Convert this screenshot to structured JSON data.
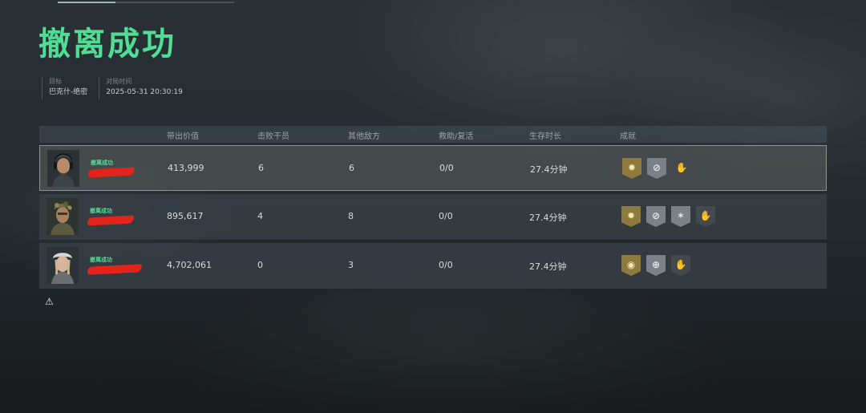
{
  "title": "撤离成功",
  "meta": {
    "target_label": "目标",
    "target_value": "巴克什-绝密",
    "time_label": "对局时间",
    "time_value": "2025-05-31 20:30:19"
  },
  "table": {
    "headers": {
      "value": "带出价值",
      "defeated": "击败干员",
      "other": "其他敌方",
      "assist": "救助/复活",
      "survive": "生存时长",
      "achievement": "成就"
    },
    "rows": [
      {
        "status": "撤离成功",
        "value": "413,999",
        "defeated": "6",
        "other": "6",
        "assist": "0/0",
        "survive": "27.4分钟",
        "badges": [
          "gold-sun-badge",
          "silver-compass-badge",
          "dark-hands-badge"
        ]
      },
      {
        "status": "撤离成功",
        "value": "895,617",
        "defeated": "4",
        "other": "8",
        "assist": "0/0",
        "survive": "27.4分钟",
        "badges": [
          "gold-sun-badge",
          "silver-compass-badge",
          "silver-star-badge",
          "dark-hands-badge"
        ]
      },
      {
        "status": "撤离成功",
        "value": "4,702,061",
        "defeated": "0",
        "other": "3",
        "assist": "0/0",
        "survive": "27.4分钟",
        "badges": [
          "gold-ring-badge",
          "silver-target-badge",
          "dark-hands-badge"
        ]
      }
    ]
  },
  "colors": {
    "accent": "#52dd95",
    "redaction": "#e4241a",
    "badge_gold": "#8d7a3c",
    "badge_silver": "#7a8288",
    "badge_dark": "#43494e"
  },
  "icons": {
    "warning": "warning-icon"
  }
}
